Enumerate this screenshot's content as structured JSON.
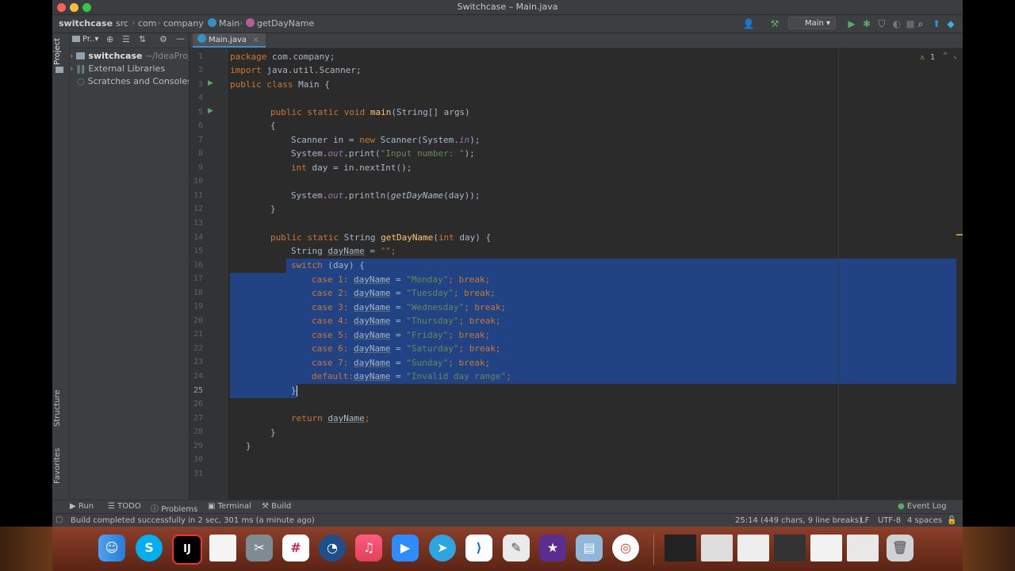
{
  "window": {
    "title": "Switchcase – Main.java"
  },
  "navbar": {
    "breadcrumbs": [
      "switchcase",
      "src",
      "com",
      "company",
      "Main",
      "getDayName"
    ],
    "run_config": "Main"
  },
  "left_stripe": {
    "project": "Project",
    "structure": "Structure",
    "favorites": "Favorites"
  },
  "project_panel": {
    "header_label": "Pr..",
    "items": [
      {
        "name": "switchcase",
        "path": "~/IdeaProj"
      },
      {
        "name": "External Libraries"
      },
      {
        "name": "Scratches and Consoles"
      }
    ]
  },
  "editor": {
    "tab": "Main.java",
    "inspection_count": "1",
    "line_numbers": [
      "1",
      "2",
      "3",
      "4",
      "5",
      "6",
      "7",
      "8",
      "9",
      "10",
      "11",
      "12",
      "13",
      "14",
      "15",
      "16",
      "17",
      "18",
      "19",
      "20",
      "21",
      "22",
      "23",
      "24",
      "25",
      "26",
      "27",
      "28",
      "29",
      "30",
      "31"
    ]
  },
  "code": {
    "l1": [
      "package",
      " com.company;"
    ],
    "l2": [
      "import",
      " java.util.Scanner;"
    ],
    "l3": [
      "public class",
      " Main {"
    ],
    "l5": [
      "public static void",
      "main",
      "(String[] args)"
    ],
    "l6": "{",
    "l7": [
      "Scanner in = ",
      "new",
      " Scanner(System.",
      "in",
      ");"
    ],
    "l8": [
      "System.",
      "out",
      ".print(",
      "\"Input number: \"",
      ");"
    ],
    "l9": [
      "int",
      " day = in.nextInt();"
    ],
    "l11": [
      "System.",
      "out",
      ".println(",
      "getDayName",
      "(day));"
    ],
    "l12": "}",
    "l14": [
      "public static",
      " String ",
      "getDayName",
      "(",
      "int",
      " day) {"
    ],
    "l15": [
      "String ",
      "dayName",
      " = ",
      "\"\"",
      ";"
    ],
    "l16": [
      "switch",
      " (day) {"
    ],
    "cases": [
      {
        "kw": "case 1:",
        "var": "dayName",
        "eq": " = ",
        "val": "\"Monday\"",
        "brk": "; break;"
      },
      {
        "kw": "case 2:",
        "var": "dayName",
        "eq": " = ",
        "val": "\"Tuesday\"",
        "brk": "; break;"
      },
      {
        "kw": "case 3:",
        "var": "dayName",
        "eq": " = ",
        "val": "\"Wednesday\"",
        "brk": "; break;"
      },
      {
        "kw": "case 4:",
        "var": "dayName",
        "eq": " = ",
        "val": "\"Thursday\"",
        "brk": "; break;"
      },
      {
        "kw": "case 5:",
        "var": "dayName",
        "eq": " = ",
        "val": "\"Friday\"",
        "brk": "; break;"
      },
      {
        "kw": "case 6:",
        "var": "dayName",
        "eq": " = ",
        "val": "\"Saturday\"",
        "brk": "; break;"
      },
      {
        "kw": "case 7:",
        "var": "dayName",
        "eq": " = ",
        "val": "\"Sunday\"",
        "brk": "; break;"
      }
    ],
    "l24": [
      "default:",
      "dayName",
      " = ",
      "\"Invalid day range\"",
      ";"
    ],
    "l25": "}",
    "l27": [
      "return",
      "dayName",
      ";"
    ],
    "l28": "}",
    "l29": "}"
  },
  "tool_tabs": {
    "run": "Run",
    "todo": "TODO",
    "problems": "Problems",
    "terminal": "Terminal",
    "build": "Build",
    "event_log": "Event Log"
  },
  "status": {
    "message": "Build completed successfully in 2 sec, 301 ms (a minute ago)",
    "position": "25:14 (449 chars, 9 line breaks)",
    "line_sep": "LF",
    "encoding": "UTF-8",
    "indent": "4 spaces"
  },
  "colors": {
    "selection": "#214283",
    "keyword": "#cc7832",
    "string": "#6a8759",
    "function": "#ffc66d",
    "field": "#9876aa"
  },
  "dock": {
    "apps": [
      "finder-icon",
      "skype-icon",
      "intellij-icon",
      "document-icon",
      "utilities-icon",
      "slack-icon",
      "quicktime-icon",
      "music-icon",
      "zoom-icon",
      "telegram-icon",
      "vscode-icon",
      "textedit-icon",
      "imovie-icon",
      "preview-icon",
      "chrome-icon"
    ],
    "intellij_label": "IJ",
    "skype_label": "S",
    "vscode_label": "⟩"
  }
}
